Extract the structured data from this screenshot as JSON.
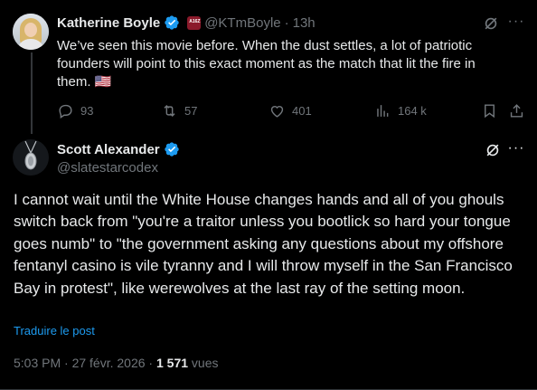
{
  "parent_tweet": {
    "author_name": "Katherine Boyle",
    "handle": "@KTmBoyle",
    "separator": "·",
    "time": "13h",
    "text": "We’ve seen this movie before. When the dust settles, a lot of patriotic founders will point to this exact moment as the match that lit the fire in them. 🇺🇸",
    "org_badge_text": "A16Z",
    "actions": {
      "replies": "93",
      "reposts": "57",
      "likes": "401",
      "views": "164 k"
    }
  },
  "main_tweet": {
    "author_name": "Scott Alexander",
    "handle": "@slatestarcodex",
    "text": "I cannot wait until the White House changes hands and all of you ghouls switch back from \"you're a traitor unless you bootlick so hard your tongue goes numb\" to \"the government asking any questions about my offshore fentanyl casino is vile tyranny and I will throw myself in the San Francisco Bay in protest\", like werewolves at the last ray of the setting moon.",
    "translate_label": "Traduire le post",
    "timestamp": "5:03 PM · 27 févr. 2026 · ",
    "views_count": "1 571",
    "views_label": " vues"
  },
  "icons": {
    "verified_color": "#1d9bf0",
    "accent_link": "#1d9bf0",
    "muted": "#71767b"
  }
}
